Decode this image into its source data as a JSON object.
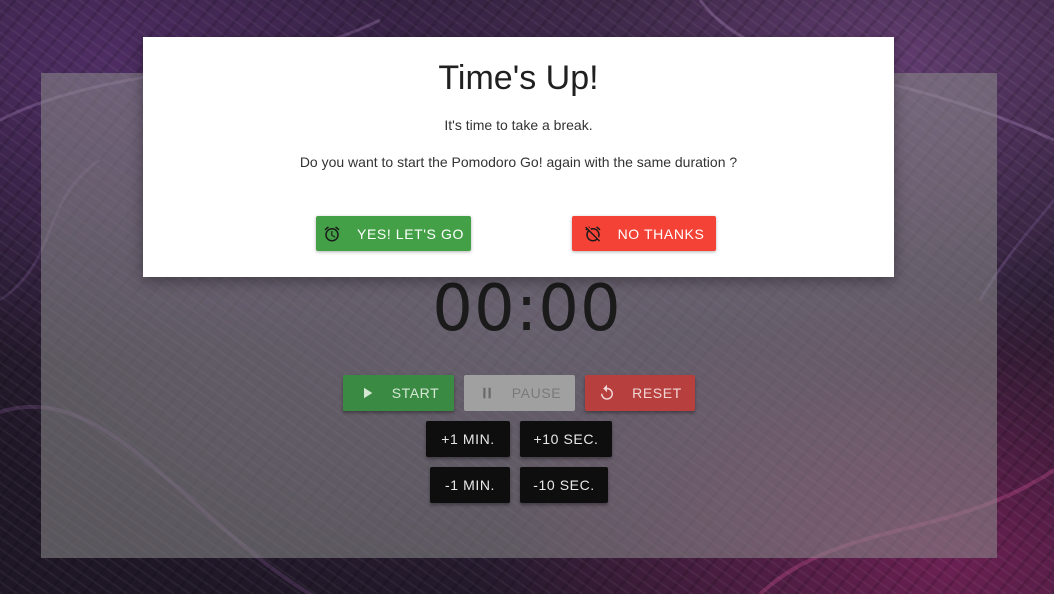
{
  "timer": {
    "display": "00:00"
  },
  "controls": {
    "start_label": "START",
    "pause_label": "PAUSE",
    "reset_label": "RESET",
    "plus_one_min_label": "+1 MIN.",
    "plus_ten_sec_label": "+10 SEC.",
    "minus_one_min_label": "-1 MIN.",
    "minus_ten_sec_label": "-10 SEC."
  },
  "modal": {
    "title": "Time's Up!",
    "message": "It's time to take a break.",
    "question": "Do you want to start the Pomodoro Go! again with the same duration ?",
    "confirm_label": "YES! LET'S GO",
    "decline_label": "NO THANKS"
  },
  "icons": {
    "start": "play-icon",
    "pause": "pause-icon",
    "reset": "reset-icon",
    "confirm": "alarm-icon",
    "decline": "alarm-off-icon"
  },
  "colors": {
    "start": "#3b8a44",
    "reset": "#b7403f",
    "confirm": "#43a047",
    "decline": "#f44336"
  }
}
